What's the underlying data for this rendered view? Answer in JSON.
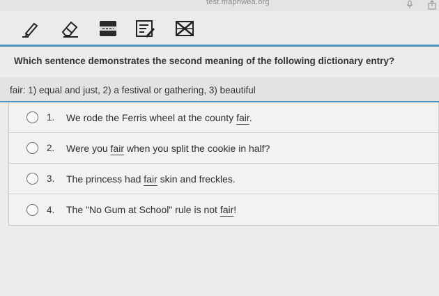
{
  "browser": {
    "url": "test.maphwea.org",
    "mic_icon": "microphone-icon",
    "share_icon": "share-icon"
  },
  "toolbar": {
    "tools": [
      {
        "name": "pencil-tool",
        "icon": "pencil-icon"
      },
      {
        "name": "eraser-tool",
        "icon": "eraser-icon"
      },
      {
        "name": "line-reader-tool",
        "icon": "line-reader-icon"
      },
      {
        "name": "notepad-tool",
        "icon": "notepad-icon"
      },
      {
        "name": "answer-eliminator-tool",
        "icon": "answer-eliminator-icon"
      }
    ]
  },
  "question": {
    "prompt": "Which sentence demonstrates the second meaning of the following dictionary entry?",
    "entry": "fair: 1) equal and just, 2) a festival or gathering, 3) beautiful"
  },
  "options": [
    {
      "number": "1.",
      "before": "We rode the Ferris wheel at the county ",
      "word": "fair",
      "after": "."
    },
    {
      "number": "2.",
      "before": "Were you ",
      "word": "fair",
      "after": " when you split the cookie in half?"
    },
    {
      "number": "3.",
      "before": "The princess had ",
      "word": "fair",
      "after": " skin and freckles."
    },
    {
      "number": "4.",
      "before": "The \"No Gum at School\" rule is not ",
      "word": "fair",
      "after": "!"
    }
  ],
  "colors": {
    "accent": "#4a92c0"
  }
}
